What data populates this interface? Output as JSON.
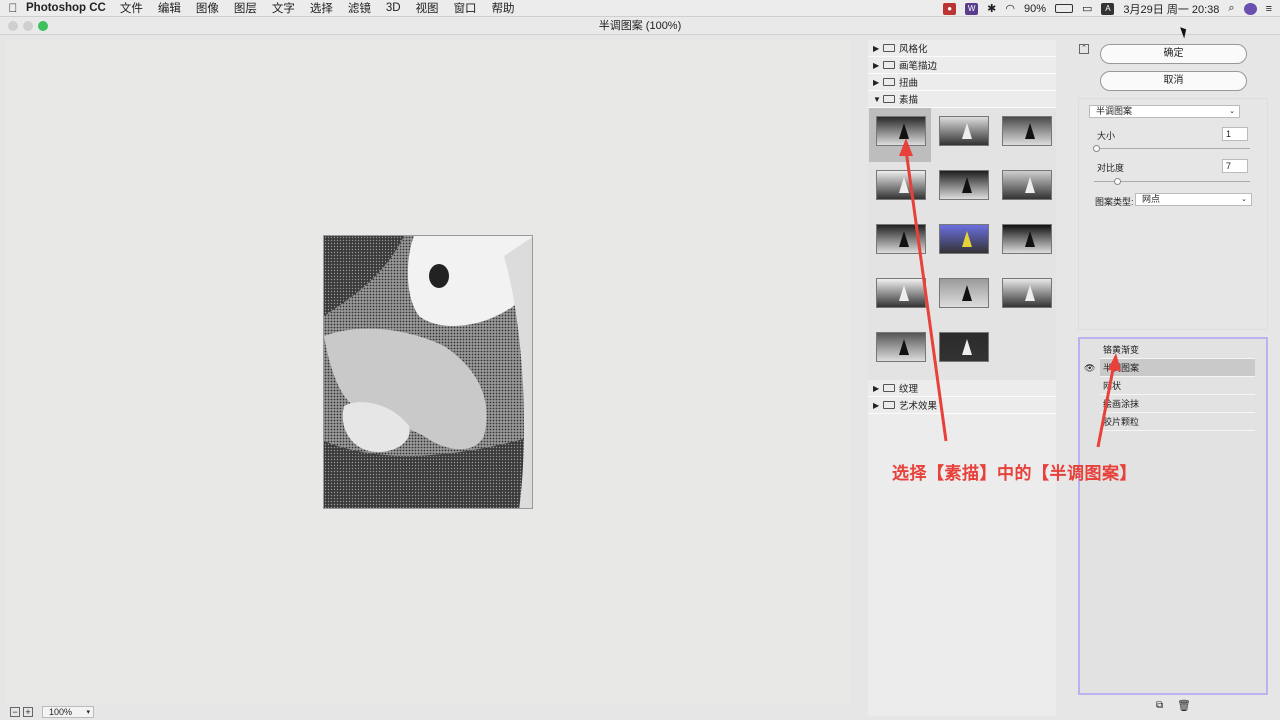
{
  "menubar": {
    "app": "Photoshop CC",
    "items": [
      "文件",
      "编辑",
      "图像",
      "图层",
      "文字",
      "选择",
      "滤镜",
      "3D",
      "视图",
      "窗口",
      "帮助"
    ],
    "battery": "90%",
    "ime": "A",
    "datetime": "3月29日 周一  20:38"
  },
  "window": {
    "title": "半调图案 (100%)"
  },
  "status": {
    "zoom": "100%"
  },
  "gallery": {
    "folders_top": [
      "风格化",
      "画笔描边",
      "扭曲",
      "素描"
    ],
    "folders_bottom": [
      "纹理",
      "艺术效果"
    ],
    "thumbnails_count": 14
  },
  "settings": {
    "ok": "确定",
    "cancel": "取消",
    "filter_select": "半调图案",
    "size_label": "大小",
    "size_value": "1",
    "contrast_label": "对比度",
    "contrast_value": "7",
    "pattern_label": "图案类型:",
    "pattern_value": "网点"
  },
  "layers": [
    "铬黄渐变",
    "半调图案",
    "网状",
    "绘画涂抹",
    "胶片颗粒"
  ],
  "annotation": "选择【素描】中的【半调图案】",
  "colors": {
    "annotation": "#e8403a",
    "layer_border": "#b9b4f0"
  }
}
